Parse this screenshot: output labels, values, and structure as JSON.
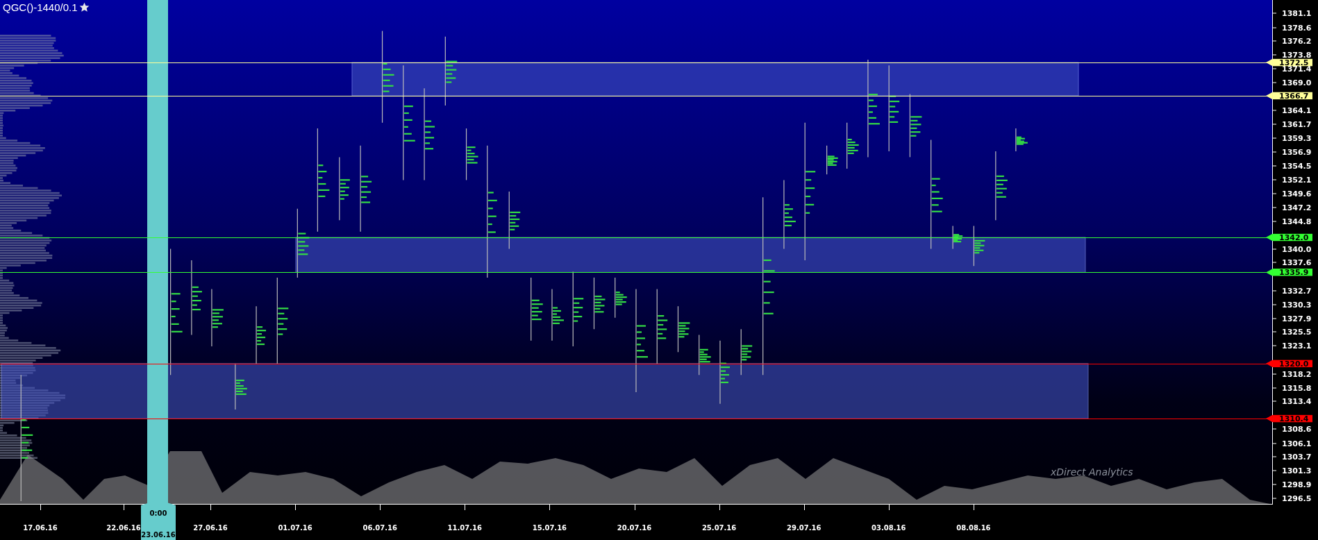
{
  "title": "QGC()-1440/0.1",
  "price_axis": {
    "labels": [
      "1381.1",
      "1378.6",
      "1376.2",
      "1373.8",
      "1371.4",
      "1369.0",
      "1364.1",
      "1361.7",
      "1359.3",
      "1356.9",
      "1354.5",
      "1352.1",
      "1349.6",
      "1347.2",
      "1344.8",
      "1340.0",
      "1337.6",
      "1332.7",
      "1330.3",
      "1327.9",
      "1325.5",
      "1323.1",
      "1318.2",
      "1315.8",
      "1313.4",
      "1308.6",
      "1306.1",
      "1303.7",
      "1301.3",
      "1298.9",
      "1296.5"
    ]
  },
  "levels": [
    {
      "label": "1372.5",
      "color": "#ffff99"
    },
    {
      "label": "1366.7",
      "color": "#ffff99"
    },
    {
      "label": "1342.0",
      "color": "#33ff33"
    },
    {
      "label": "1335.9",
      "color": "#33ff33"
    },
    {
      "label": "1320.0",
      "color": "#ff0000"
    },
    {
      "label": "1310.4",
      "color": "#ff0000"
    }
  ],
  "date_axis": {
    "labels": [
      "17.06.16",
      "22.06.16",
      "27.06.16",
      "01.07.16",
      "06.07.16",
      "11.07.16",
      "15.07.16",
      "20.07.16",
      "25.07.16",
      "29.07.16",
      "03.08.16",
      "08.08.16"
    ]
  },
  "cursor": {
    "time": "0:00",
    "date": "23.06.16"
  },
  "brand": "xDirect Analytics"
}
